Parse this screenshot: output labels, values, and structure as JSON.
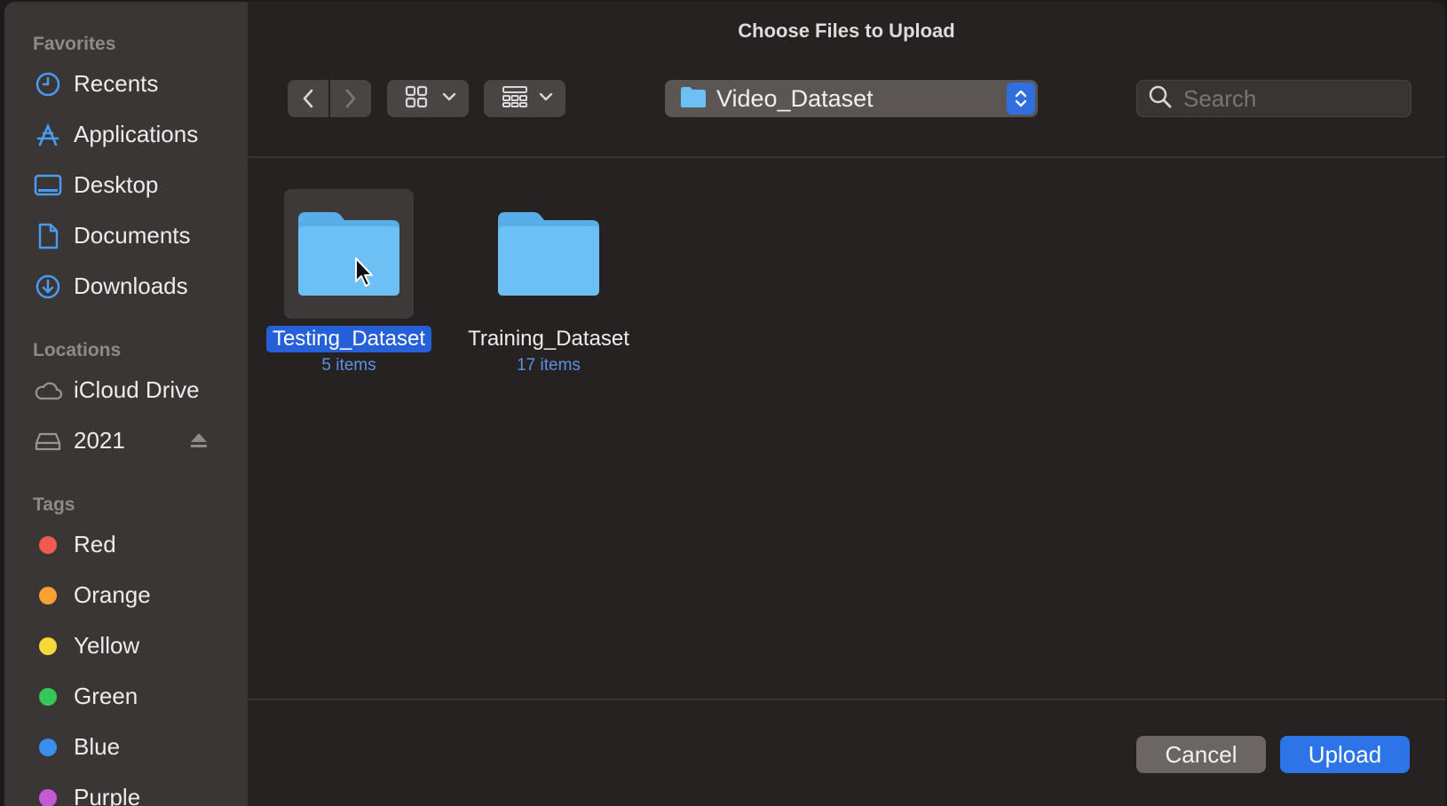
{
  "dialog": {
    "title": "Choose Files to Upload"
  },
  "sidebar": {
    "favorites_title": "Favorites",
    "favorites": [
      {
        "label": "Recents",
        "icon": "clock-icon"
      },
      {
        "label": "Applications",
        "icon": "applications-icon"
      },
      {
        "label": "Desktop",
        "icon": "desktop-icon"
      },
      {
        "label": "Documents",
        "icon": "document-icon"
      },
      {
        "label": "Downloads",
        "icon": "download-icon"
      }
    ],
    "locations_title": "Locations",
    "locations": [
      {
        "label": "iCloud Drive",
        "icon": "cloud-icon"
      },
      {
        "label": "2021",
        "icon": "drive-icon",
        "ejectable": true
      }
    ],
    "tags_title": "Tags",
    "tags": [
      {
        "label": "Red",
        "color": "#f05a4f"
      },
      {
        "label": "Orange",
        "color": "#f6a230"
      },
      {
        "label": "Yellow",
        "color": "#f6d83a"
      },
      {
        "label": "Green",
        "color": "#35c759"
      },
      {
        "label": "Blue",
        "color": "#3b8ef0"
      },
      {
        "label": "Purple",
        "color": "#c45ad6"
      }
    ]
  },
  "toolbar": {
    "path_label": "Video_Dataset",
    "search_placeholder": "Search"
  },
  "files": [
    {
      "name": "Testing_Dataset",
      "count": "5 items",
      "selected": true
    },
    {
      "name": "Training_Dataset",
      "count": "17 items",
      "selected": false
    }
  ],
  "buttons": {
    "cancel": "Cancel",
    "upload": "Upload"
  },
  "colors": {
    "accent": "#2d74e8",
    "folder": "#6cc0f5",
    "sidebar_icon": "#4b9bf0"
  }
}
